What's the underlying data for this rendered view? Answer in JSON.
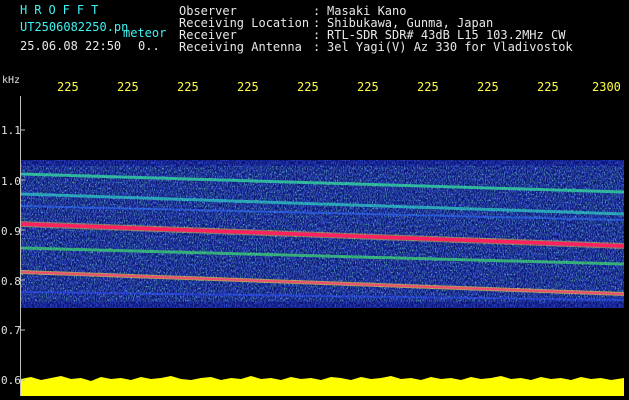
{
  "header": {
    "brand": "HROFFT",
    "filename": "UT2506082250.pn",
    "mode": "meteor",
    "timestamp": "25.06.08 22:50",
    "extra": "0..",
    "fields": [
      {
        "label": "Observer",
        "colon": ":",
        "value": "Masaki Kano"
      },
      {
        "label": "Receiving Location",
        "colon": ":",
        "value": "Shibukawa, Gunma, Japan"
      },
      {
        "label": "Receiver",
        "colon": ":",
        "value": "RTL-SDR SDR# 43dB L15 103.2MHz CW"
      },
      {
        "label": "Receiving Antenna",
        "colon": ":",
        "value": "3el Yagi(V) Az 330 for Vladivostok"
      }
    ]
  },
  "axis": {
    "y_unit": "kHz",
    "y_ticks": [
      "1.1",
      "1.0",
      "0.9",
      "0.8",
      "0.7",
      "0.6"
    ],
    "x_ticks": [
      "225",
      "225",
      "225",
      "225",
      "225",
      "225",
      "225",
      "225",
      "225",
      "2300"
    ]
  },
  "colors": {
    "background": "#000000",
    "header_cyan": "#3ef3f3",
    "tick_yellow": "#ffff40",
    "band_red": "#ff2060",
    "noise_blue": "#1a2bd8",
    "signal_green": "#30e060",
    "power_yellow": "#ffff00"
  }
}
